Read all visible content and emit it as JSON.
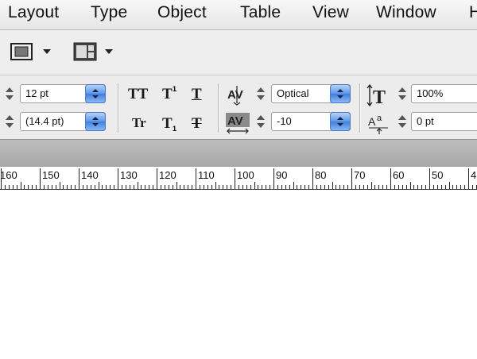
{
  "menubar": {
    "items": [
      "Layout",
      "Type",
      "Object",
      "Table",
      "View",
      "Window",
      "H"
    ]
  },
  "frame_toolbar": {
    "fitting_icon": "frame-fitting-icon",
    "view_icon": "screen-mode-icon"
  },
  "character": {
    "font_size": "12 pt",
    "leading": "(14.4 pt)",
    "tracking_kerning": "Optical",
    "tracking": "-10",
    "vertical_scale": "100%",
    "baseline_shift": "0 pt"
  },
  "style_buttons": {
    "all_caps": "TT",
    "superscript": "T",
    "superscript_mark": "1",
    "underline": "T",
    "small_caps": "Tr",
    "subscript": "T",
    "subscript_mark": "1",
    "strikethrough": "T"
  },
  "ruler": {
    "labels": [
      "160",
      "150",
      "140",
      "130",
      "120",
      "110",
      "100",
      "90",
      "80",
      "70",
      "60",
      "50",
      "4"
    ]
  },
  "colors": {
    "accent": "#5c96ea",
    "menubar": "#eeeeee",
    "band": "#b3b3b3"
  }
}
